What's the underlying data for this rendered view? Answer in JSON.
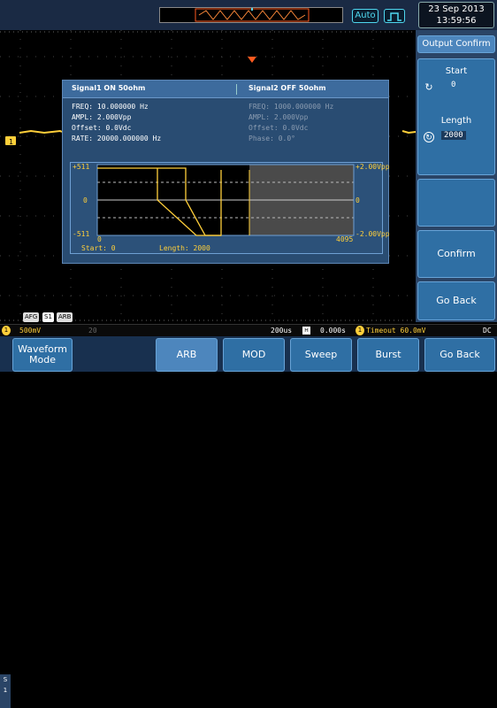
{
  "topbar": {
    "auto_label": "Auto",
    "date": "23 Sep 2013",
    "time": "13:59:56"
  },
  "dialog": {
    "signal1_title": "Signal1 ON 50ohm",
    "signal2_title": "Signal2 OFF 50ohm",
    "signal1_lines": [
      "FREQ: 10.000000 Hz",
      "AMPL: 2.000Vpp",
      "Offset: 0.0Vdc",
      "RATE: 20000.000000 Hz"
    ],
    "signal2_lines": [
      "FREQ: 1000.000000 Hz",
      "AMPL: 2.000Vpp",
      "Offset: 0.0Vdc",
      "Phase: 0.0°"
    ],
    "plot": {
      "y_top": "+511",
      "y_mid": "0",
      "y_bot": "-511",
      "x_start": "0",
      "x_end": "4095",
      "right_top": "+2.00Vpp",
      "right_mid": "0",
      "right_bot": "-2.00Vpp",
      "start_label": "Start: 0",
      "length_label": "Length: 2000"
    }
  },
  "right_panel": {
    "title": "Output Confirm",
    "start_label": "Start",
    "start_value": "0",
    "length_label": "Length",
    "length_value": "2000",
    "confirm_label": "Confirm",
    "goback_label": "Go Back"
  },
  "status": {
    "afg": "AFG",
    "s1": "S1",
    "arb": "ARB",
    "ch1_scale": "500mV",
    "ch2_scale": "20",
    "timebase": "200us",
    "delay": "0.000s",
    "trigger": "Timeout 60.0mV",
    "coupling": "DC"
  },
  "menu": {
    "waveform_mode": "Waveform Mode",
    "arb": "ARB",
    "mod": "MOD",
    "sweep": "Sweep",
    "burst": "Burst",
    "goback": "Go Back",
    "side_s": "S",
    "side_1": "1"
  },
  "colors": {
    "accent_cyan": "#4fd8f0",
    "ch1_yellow": "#ffcf3a",
    "trigger_orange": "#ff5a1f"
  }
}
